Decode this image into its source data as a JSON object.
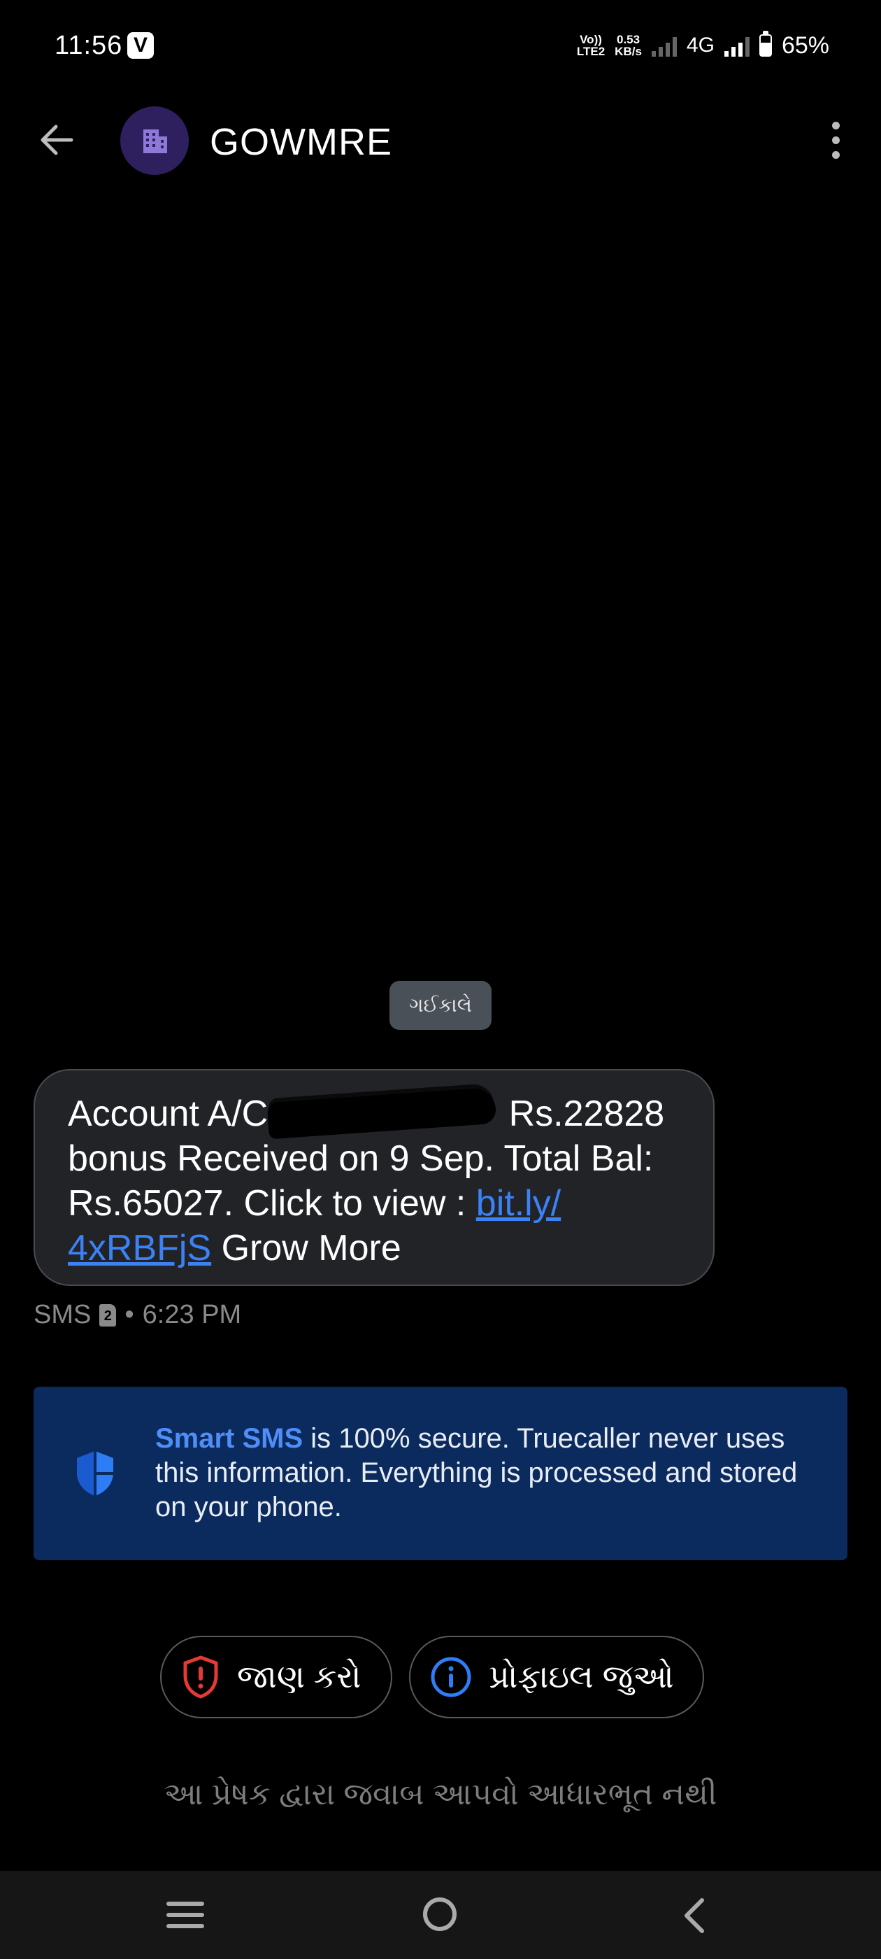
{
  "status_bar": {
    "time": "11:56",
    "app_badge": "V",
    "volte_line1": "Vo))",
    "volte_line2": "LTE2",
    "speed_value": "0.53",
    "speed_unit": "KB/s",
    "network": "4G",
    "battery_percent": "65%",
    "battery_level": 0.65
  },
  "header": {
    "contact_name": "GOWMRE",
    "avatar_icon": "building-icon",
    "avatar_color": "#2e1f5e"
  },
  "conversation": {
    "date_chip": "ગઈકાલે",
    "message": {
      "text_start": "Account A/C",
      "text_after_redaction": " Rs.22828\nbonus Received on 9 Sep. Total Bal:\nRs.65027. Click to view : ",
      "link_line1": "bit.ly/",
      "link_line2": "4xRBFjS",
      "text_end": " Grow More",
      "type_label": "SMS",
      "sim_number": "2",
      "separator": "•",
      "time": "6:23 PM"
    }
  },
  "info_card": {
    "brand": "Smart SMS",
    "text": " is 100% secure. Truecaller never uses this information. Everything is processed and stored on your phone.",
    "background": "#0b2b5e"
  },
  "actions": {
    "report_label": "જાણ કરો",
    "profile_label": "પ્રોફાઇલ જુઓ"
  },
  "footer_note": "આ પ્રેષક દ્વારા જવાબ આપવો આધારભૂત નથી",
  "colors": {
    "link": "#3b82f6",
    "report_red": "#e53935",
    "info_blue": "#2f7df6"
  }
}
